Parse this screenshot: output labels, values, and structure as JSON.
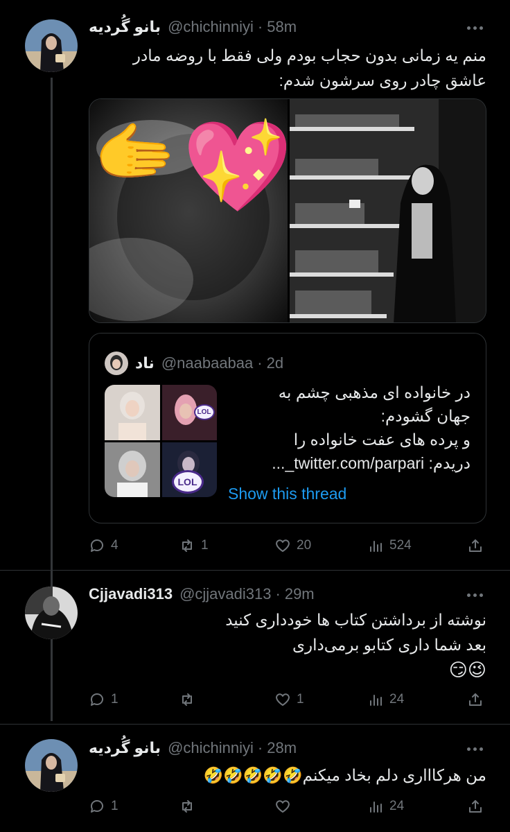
{
  "tweets": [
    {
      "name": "بانو گُردیه",
      "handle": "@chichinniyi",
      "dot": "·",
      "time": "58m",
      "text_line1": "منم یه زمانی بدون حجاب بودم ولی فقط با روضه مادر",
      "text_line2": "عاشق چادر روی سرشون شدم:",
      "quote": {
        "name": "ناد",
        "handle": "@naabaabaa",
        "dot": "·",
        "time": "2d",
        "line1": "در خانواده ای مذهبی چشم به",
        "line2": "جهان گشودم:",
        "line3": "و پرده های عفت خانواده را",
        "line4": "دریدم: twitter.com/parpari_...",
        "link": "Show this thread",
        "badge1": "LOL",
        "badge2": "LOL"
      },
      "stats": {
        "replies": "4",
        "retweets": "1",
        "likes": "20",
        "views": "524"
      }
    },
    {
      "name": "Cjjavadi313",
      "handle": "@cjjavadi313",
      "dot": "·",
      "time": "29m",
      "text_line1": "نوشته از برداشتن کتاب ها خودداری کنید",
      "text_line2": "بعد شما داری  کتابو برمی‌داری",
      "text_line3": "😉😏",
      "stats": {
        "replies": "1",
        "retweets": "",
        "likes": "1",
        "views": "24"
      }
    },
    {
      "name": "بانو گُردیه",
      "handle": "@chichinniyi",
      "dot": "·",
      "time": "28m",
      "text_line1": "من هرکاااری دلم بخاد میکنم🤣🤣🤣🤣🤣",
      "stats": {
        "replies": "1",
        "retweets": "",
        "likes": "",
        "views": "24"
      }
    }
  ],
  "media_emojis": {
    "hand": "🫱",
    "heart": "💖"
  },
  "colors": {
    "background": "#000000",
    "text": "#e7e9ea",
    "muted": "#71767b",
    "link": "#1d9bf0",
    "border": "#2f3336"
  }
}
